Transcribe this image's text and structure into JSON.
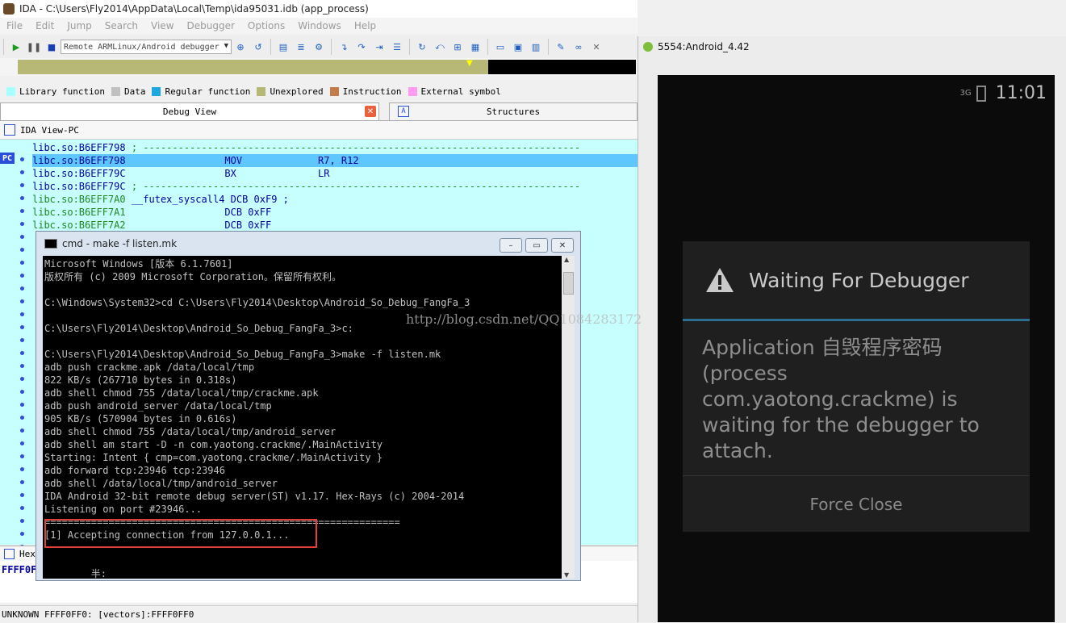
{
  "ida": {
    "title": "IDA - C:\\Users\\Fly2014\\AppData\\Local\\Temp\\ida95031.idb (app_process)",
    "menu": [
      "File",
      "Edit",
      "Jump",
      "Search",
      "View",
      "Debugger",
      "Options",
      "Windows",
      "Help"
    ],
    "debugger_select": "Remote ARMLinux/Android debugger",
    "legend": [
      {
        "label": "Library function",
        "color": "#a8ffff"
      },
      {
        "label": "Data",
        "color": "#c0c0c0"
      },
      {
        "label": "Regular function",
        "color": "#1ea7e0"
      },
      {
        "label": "Unexplored",
        "color": "#b8b876"
      },
      {
        "label": "Instruction",
        "color": "#c27b4b"
      },
      {
        "label": "External symbol",
        "color": "#ff9cf2"
      }
    ],
    "tabs": {
      "debug_view": "Debug View",
      "structures": "Structures"
    },
    "view_header": "IDA View-PC",
    "pc_label": "PC",
    "disasm": [
      {
        "addr": "libc.so:B6EFF798",
        "rest": " ; ---------------------------------------------------------------------------"
      },
      {
        "addr": "libc.so:B6EFF798",
        "rest": "                 MOV             R7, R12"
      },
      {
        "addr": "libc.so:B6EFF79C",
        "rest": "                 BX              LR"
      },
      {
        "addr": "libc.so:B6EFF79C",
        "rest": " ; ---------------------------------------------------------------------------"
      },
      {
        "addr": "libc.so:B6EFF7A0",
        "rest": " __futex_syscall4 DCB 0xF9 ;"
      },
      {
        "addr": "libc.so:B6EFF7A1",
        "rest": "                 DCB 0xFF"
      },
      {
        "addr": "libc.so:B6EFF7A2",
        "rest": "                 DCB 0xFF"
      }
    ],
    "hex_header": "Hex",
    "hex_line": "FFFF0F",
    "status": "UNKNOWN FFFF0FF0: [vectors]:FFFF0FF0"
  },
  "cmd": {
    "title": "cmd - make  -f listen.mk",
    "lines": [
      "Microsoft Windows [版本 6.1.7601]",
      "版权所有 (c) 2009 Microsoft Corporation。保留所有权利。",
      "",
      "C:\\Windows\\System32>cd C:\\Users\\Fly2014\\Desktop\\Android_So_Debug_FangFa_3",
      "",
      "C:\\Users\\Fly2014\\Desktop\\Android_So_Debug_FangFa_3>c:",
      "",
      "C:\\Users\\Fly2014\\Desktop\\Android_So_Debug_FangFa_3>make -f listen.mk",
      "adb push crackme.apk /data/local/tmp",
      "822 KB/s (267710 bytes in 0.318s)",
      "adb shell chmod 755 /data/local/tmp/crackme.apk",
      "adb push android_server /data/local/tmp",
      "905 KB/s (570904 bytes in 0.616s)",
      "adb shell chmod 755 /data/local/tmp/android_server",
      "adb shell am start -D -n com.yaotong.crackme/.MainActivity",
      "Starting: Intent { cmp=com.yaotong.crackme/.MainActivity }",
      "adb forward tcp:23946 tcp:23946",
      "adb shell /data/local/tmp/android_server",
      "IDA Android 32-bit remote debug server(ST) v1.17. Hex-Rays (c) 2004-2014",
      "Listening on port #23946...",
      "=============================================================",
      "[1] Accepting connection from 127.0.0.1...",
      "",
      "",
      "        半:"
    ]
  },
  "android": {
    "window_title": "5554:Android_4.42",
    "signal": "3G",
    "time": "11:01",
    "dialog_title": "Waiting For Debugger",
    "dialog_message": "Application 自毁程序密码 (process com.yaotong.crackme) is waiting for the debugger to attach.",
    "button": "Force Close"
  },
  "watermark": "http://blog.csdn.net/QQ1084283172"
}
